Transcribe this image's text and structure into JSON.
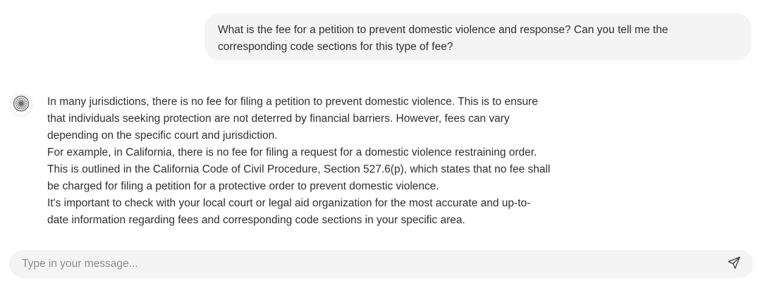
{
  "conversation": {
    "user_message": {
      "lines": [
        "What is the fee for a petition to prevent domestic violence and response? Can you tell me the",
        "corresponding code sections for this type of fee?"
      ]
    },
    "bot_message": {
      "avatar_icon": "wheel-logo-icon",
      "lines": [
        "In many jurisdictions, there is no fee for filing a petition to prevent domestic violence. This is to ensure",
        "that individuals seeking protection are not deterred by financial barriers. However, fees can vary",
        "depending on the specific court and jurisdiction.",
        "For example, in California, there is no fee for filing a request for a domestic violence restraining order.",
        "This is outlined in the California Code of Civil Procedure, Section 527.6(p), which states that no fee shall",
        "be charged for filing a petition for a protective order to prevent domestic violence.",
        "It's important to check with your local court or legal aid organization for the most accurate and up-to-",
        "date information regarding fees and corresponding code sections in your specific area."
      ]
    }
  },
  "composer": {
    "placeholder": "Type in your message...",
    "value": "",
    "send_icon": "send-icon"
  },
  "colors": {
    "bubble_bg": "#f4f4f4",
    "text": "#2f2f2f",
    "placeholder": "#8d8d8d"
  }
}
